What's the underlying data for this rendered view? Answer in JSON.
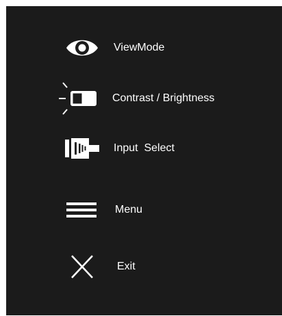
{
  "menu": {
    "items": [
      {
        "label": "ViewMode",
        "icon": "eye-icon"
      },
      {
        "label": "Contrast / Brightness",
        "icon": "contrast-brightness-icon"
      },
      {
        "label": "Input  Select",
        "icon": "input-plug-icon"
      },
      {
        "label": "Menu",
        "icon": "hamburger-menu-icon"
      },
      {
        "label": "Exit",
        "icon": "close-x-icon"
      }
    ]
  },
  "colors": {
    "panel_background": "#1b1b1b",
    "foreground": "#ffffff"
  }
}
